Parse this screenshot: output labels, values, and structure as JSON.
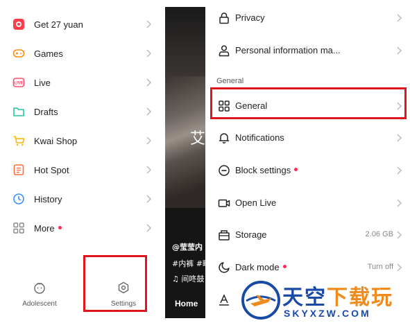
{
  "left_menu": {
    "items": [
      {
        "label": "Get 27 yuan",
        "icon": "gift-icon",
        "color": "#fe3c4b",
        "dot": false
      },
      {
        "label": "Games",
        "icon": "gamepad-icon",
        "color": "#ff8a00",
        "dot": false
      },
      {
        "label": "Live",
        "icon": "live-icon",
        "color": "#ff4d6d",
        "dot": false
      },
      {
        "label": "Drafts",
        "icon": "folder-icon",
        "color": "#22c3a6",
        "dot": false
      },
      {
        "label": "Kwai Shop",
        "icon": "cart-icon",
        "color": "#ffb300",
        "dot": false
      },
      {
        "label": "Hot Spot",
        "icon": "fire-doc-icon",
        "color": "#ff6a3d",
        "dot": false
      },
      {
        "label": "History",
        "icon": "clock-icon",
        "color": "#3a8cff",
        "dot": false
      },
      {
        "label": "More",
        "icon": "grid-icon",
        "color": "#888888",
        "dot": true
      }
    ],
    "bottom": {
      "adolescent_label": "Adolescent",
      "settings_label": "Settings"
    }
  },
  "video": {
    "overlay_char": "艾",
    "username": "@莹莹内",
    "tags": "#内裤 #畦",
    "music": "♫ 间咚鼓",
    "home_label": "Home"
  },
  "settings": {
    "top_items": [
      {
        "label": "Privacy",
        "icon": "lock-icon"
      },
      {
        "label": "Personal information ma...",
        "icon": "person-icon"
      }
    ],
    "section_title": "General",
    "items": [
      {
        "label": "General",
        "icon": "grid-icon",
        "value": "",
        "dot": false
      },
      {
        "label": "Notifications",
        "icon": "bell-icon",
        "value": "",
        "dot": false
      },
      {
        "label": "Block settings",
        "icon": "block-icon",
        "value": "",
        "dot": true
      },
      {
        "label": "Open Live",
        "icon": "video-camera-icon",
        "value": "",
        "dot": false
      },
      {
        "label": "Storage",
        "icon": "storage-icon",
        "value": "2.06 GB",
        "dot": false
      },
      {
        "label": "Dark mode",
        "icon": "moon-icon",
        "value": "Turn off",
        "dot": true
      },
      {
        "label": "A",
        "icon": "font-icon",
        "value": "",
        "dot": false
      }
    ]
  },
  "watermark": {
    "main_blue": "天空",
    "main_orange": "下载玩",
    "sub": "SKYXZW.COM"
  },
  "colors": {
    "highlight": "#e0141c",
    "dot": "#fe2c55"
  }
}
